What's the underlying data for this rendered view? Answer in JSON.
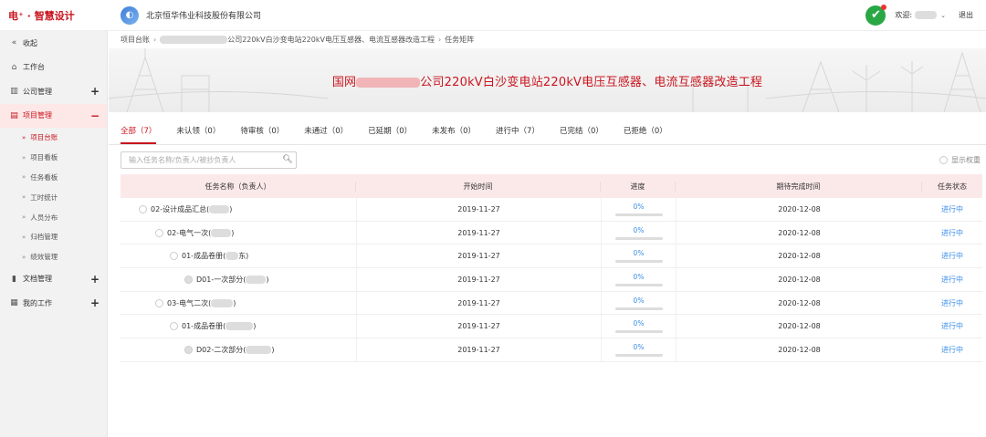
{
  "header": {
    "logo_mark": "电",
    "logo_text": "电⁺ · 智慧设计",
    "company": "北京恒华伟业科技股份有限公司",
    "welcome": "欢迎:",
    "logout": "退出"
  },
  "sidebar": {
    "collapse": "收起",
    "items": [
      {
        "label": "工作台",
        "icon": "home-icon"
      },
      {
        "label": "公司管理",
        "icon": "building-icon",
        "expand": "+"
      },
      {
        "label": "项目管理",
        "icon": "project-icon",
        "expand": "−"
      }
    ],
    "subitems": [
      "项目台账",
      "项目看板",
      "任务看板",
      "工时统计",
      "人员分布",
      "归档管理",
      "绩效管理"
    ],
    "more": [
      {
        "label": "文档管理",
        "icon": "document-icon",
        "expand": "+"
      },
      {
        "label": "我的工作",
        "icon": "work-icon",
        "expand": "+"
      }
    ]
  },
  "breadcrumb": {
    "root": "项目台账",
    "project": "公司220kV白沙变电站220kV电压互感器、电流互感器改造工程",
    "current": "任务矩阵"
  },
  "banner": {
    "prefix": "国网",
    "title": "公司220kV白沙变电站220kV电压互感器、电流互感器改造工程"
  },
  "tabs": [
    {
      "label": "全部（7）"
    },
    {
      "label": "未认领（0）"
    },
    {
      "label": "待审核（0）"
    },
    {
      "label": "未通过（0）"
    },
    {
      "label": "已延期（0）"
    },
    {
      "label": "未发布（0）"
    },
    {
      "label": "进行中（7）"
    },
    {
      "label": "已完结（0）"
    },
    {
      "label": "已拒绝（0）"
    }
  ],
  "search": {
    "placeholder": "输入任务名称/负责人/被抄负责人"
  },
  "perm_label": "显示权重",
  "table": {
    "headers": [
      "任务名称（负责人）",
      "开始时间",
      "进度",
      "期待完成时间",
      "任务状态"
    ],
    "rows": [
      {
        "name": "02-设计成品汇总(",
        "suffix": ")",
        "level": 0,
        "start": "2019-11-27",
        "progress": "0%",
        "end": "2020-12-08",
        "status": "进行中"
      },
      {
        "name": "02-电气一次(",
        "suffix": ")",
        "level": 1,
        "start": "2019-11-27",
        "progress": "0%",
        "end": "2020-12-08",
        "status": "进行中"
      },
      {
        "name": "01-成品卷册(",
        "suffix": "东)",
        "level": 2,
        "start": "2019-11-27",
        "progress": "0%",
        "end": "2020-12-08",
        "status": "进行中"
      },
      {
        "name": "D01-一次部分(",
        "suffix": ")",
        "level": 3,
        "start": "2019-11-27",
        "progress": "0%",
        "end": "2020-12-08",
        "status": "进行中"
      },
      {
        "name": "03-电气二次(",
        "suffix": ")",
        "level": 1,
        "start": "2019-11-27",
        "progress": "0%",
        "end": "2020-12-08",
        "status": "进行中"
      },
      {
        "name": "01-成品卷册(",
        "suffix": ")",
        "level": 2,
        "start": "2019-11-27",
        "progress": "0%",
        "end": "2020-12-08",
        "status": "进行中"
      },
      {
        "name": "D02-二次部分(",
        "suffix": ")",
        "level": 3,
        "start": "2019-11-27",
        "progress": "0%",
        "end": "2020-12-08",
        "status": "进行中"
      }
    ]
  }
}
